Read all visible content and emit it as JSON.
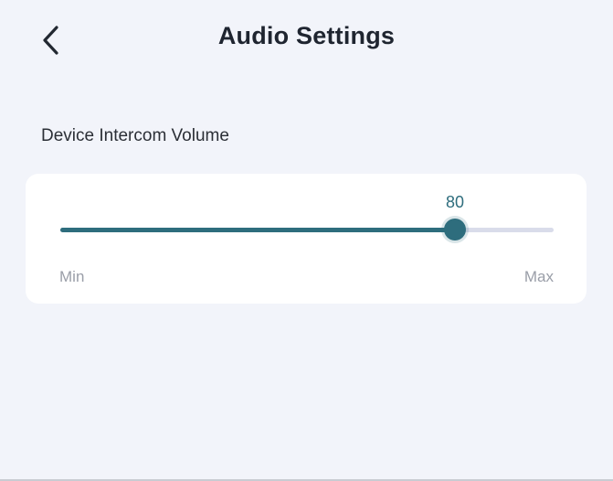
{
  "header": {
    "title": "Audio Settings",
    "back_icon": "chevron-left-icon"
  },
  "volume": {
    "label": "Device Intercom Volume",
    "value": 80,
    "value_text": "80",
    "min_label": "Min",
    "max_label": "Max",
    "min": 0,
    "max": 100
  },
  "colors": {
    "accent": "#2e6d7d",
    "track": "#d9dcea",
    "background": "#f2f4fa",
    "card": "#ffffff"
  }
}
